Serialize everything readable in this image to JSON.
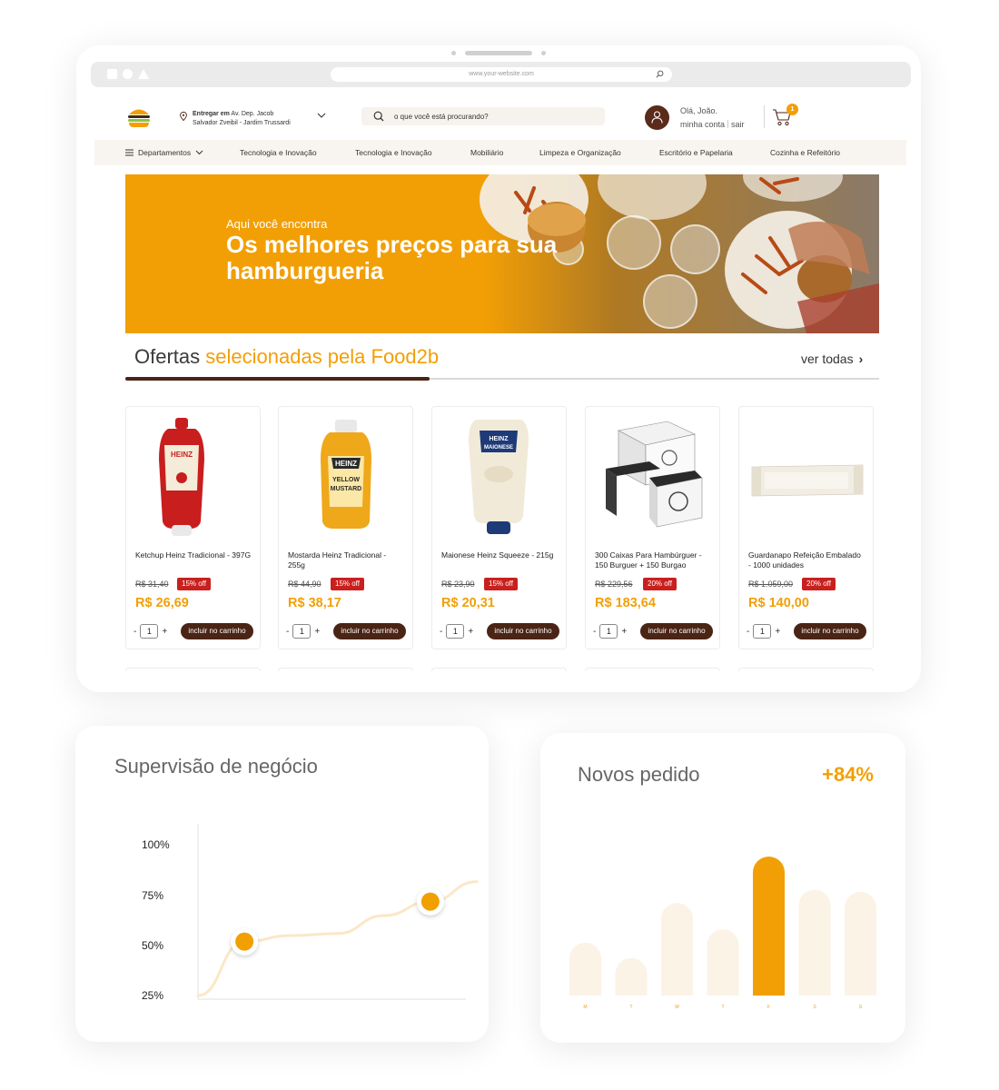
{
  "browser": {
    "url": "www.your-website.com"
  },
  "header": {
    "deliver_prefix": "Entregar em",
    "deliver_line1": "Av. Dep. Jacob",
    "deliver_line2": "Salvador Zveibil - Jardim Trussardi",
    "search_placeholder": "o que você está procurando?",
    "greeting": "Olá, João.",
    "account_link": "minha conta",
    "logout_link": "sair",
    "cart_count": "1"
  },
  "nav": {
    "departments_label": "Departamentos",
    "items": [
      "Tecnologia e Inovação",
      "Tecnologia e Inovação",
      "Mobiliário",
      "Limpeza e Organização",
      "Escritório e Papelaria",
      "Cozinha e Refeitório"
    ]
  },
  "banner": {
    "kicker": "Aqui você encontra",
    "headline": "Os melhores preços para sua hamburgueria"
  },
  "offers": {
    "title_plain": "Ofertas",
    "title_accent": "selecionadas pela Food2b",
    "see_all": "ver todas"
  },
  "products": [
    {
      "name": "Ketchup Heinz Tradicional - 397G",
      "old_price": "R$ 31,40",
      "discount": "15% off",
      "price": "R$ 26,69",
      "qty": "1",
      "add_label": "incluir no carrinho"
    },
    {
      "name": "Mostarda Heinz  Tradicional - 255g",
      "old_price": "R$ 44,90",
      "discount": "15% off",
      "price": "R$ 38,17",
      "qty": "1",
      "add_label": "incluir no carrinho"
    },
    {
      "name": "Maionese Heinz Squeeze - 215g",
      "old_price": "R$ 23,90",
      "discount": "15% off",
      "price": "R$ 20,31",
      "qty": "1",
      "add_label": "incluir no carrinho"
    },
    {
      "name": "300 Caixas Para Hambúrguer - 150 Burguer + 150 Burgao",
      "old_price": "R$ 229,56",
      "discount": "20% off",
      "price": "R$ 183,64",
      "qty": "1",
      "add_label": "incluir no carrinho"
    },
    {
      "name": "Guardanapo Refeição Embalado - 1000 unidades",
      "old_price": "R$ 1.059,00",
      "discount": "20% off",
      "price": "R$ 140,00",
      "qty": "1",
      "add_label": "incluir no carrinho"
    }
  ],
  "qty_controls": {
    "minus": "-",
    "plus": "+"
  },
  "panels": {
    "supervision": {
      "title": "Supervisão de negócio"
    },
    "orders": {
      "title": "Novos pedido",
      "change": "+84%"
    }
  },
  "chart_data": [
    {
      "type": "line",
      "title": "Supervisão de negócio",
      "yticks": [
        "100%",
        "75%",
        "50%",
        "25%"
      ],
      "ylim": [
        25,
        100
      ],
      "x": [
        0,
        1,
        2,
        3,
        4,
        5,
        6
      ],
      "values": [
        25,
        52,
        55,
        56,
        65,
        72,
        82
      ],
      "highlighted_points": [
        1,
        5
      ],
      "grid": false
    },
    {
      "type": "bar",
      "title": "Novos pedido",
      "categories": [
        "M",
        "T",
        "W",
        "T",
        "F",
        "S",
        "S"
      ],
      "values": [
        24,
        17,
        42,
        30,
        63,
        48,
        47
      ],
      "highlighted_index": 4,
      "colors": {
        "bar": "#fbf3e6",
        "highlight": "#f29f05",
        "label": "#f29f05"
      }
    }
  ],
  "colors": {
    "accent": "#f29f05",
    "brown": "#4a2414",
    "discount": "#c8201e"
  }
}
